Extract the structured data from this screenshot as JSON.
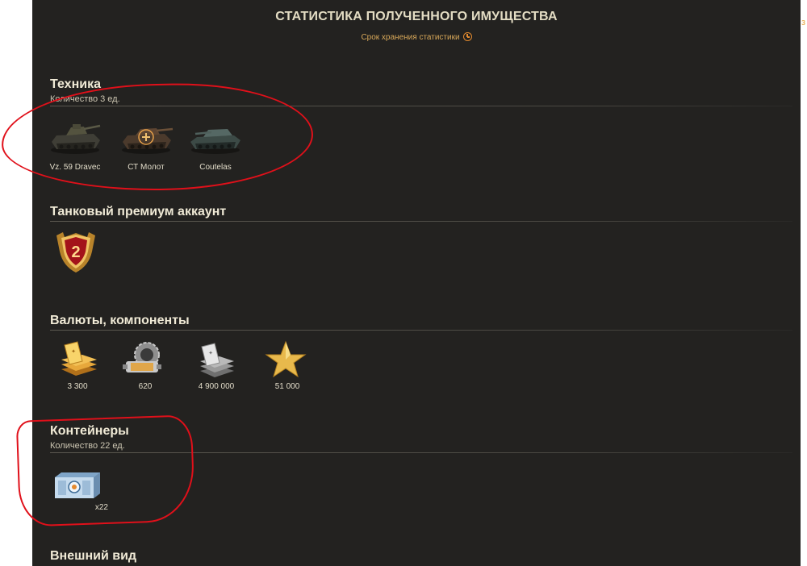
{
  "header": {
    "title": "СТАТИСТИКА ПОЛУЧЕННОГО ИМУЩЕСТВА",
    "storage_link": "Срок хранения статистики",
    "corner_char": "з"
  },
  "sections": {
    "vehicles": {
      "title": "Техника",
      "count": "Количество 3 ед.",
      "items": [
        {
          "name": "Vz. 59 Dravec",
          "icon": "tank-icon"
        },
        {
          "name": "СТ Молот",
          "icon": "tank-icon"
        },
        {
          "name": "Coutelas",
          "icon": "tank-icon"
        }
      ]
    },
    "premium": {
      "title": "Танковый премиум аккаунт",
      "badge_value": "2"
    },
    "currencies": {
      "title": "Валюты, компоненты",
      "items": [
        {
          "value": "3 300",
          "icon": "gold-icon"
        },
        {
          "value": "620",
          "icon": "bonds-icon"
        },
        {
          "value": "4 900 000",
          "icon": "credits-icon"
        },
        {
          "value": "51 000",
          "icon": "free-xp-star-icon"
        }
      ]
    },
    "containers": {
      "title": "Контейнеры",
      "count": "Количество 22 ед.",
      "items": [
        {
          "qty": "x22",
          "icon": "container-icon"
        }
      ]
    },
    "appearance": {
      "title": "Внешний вид"
    }
  },
  "colors": {
    "background": "#232220",
    "accent": "#e48a2e",
    "annotation": "#e0101a"
  }
}
